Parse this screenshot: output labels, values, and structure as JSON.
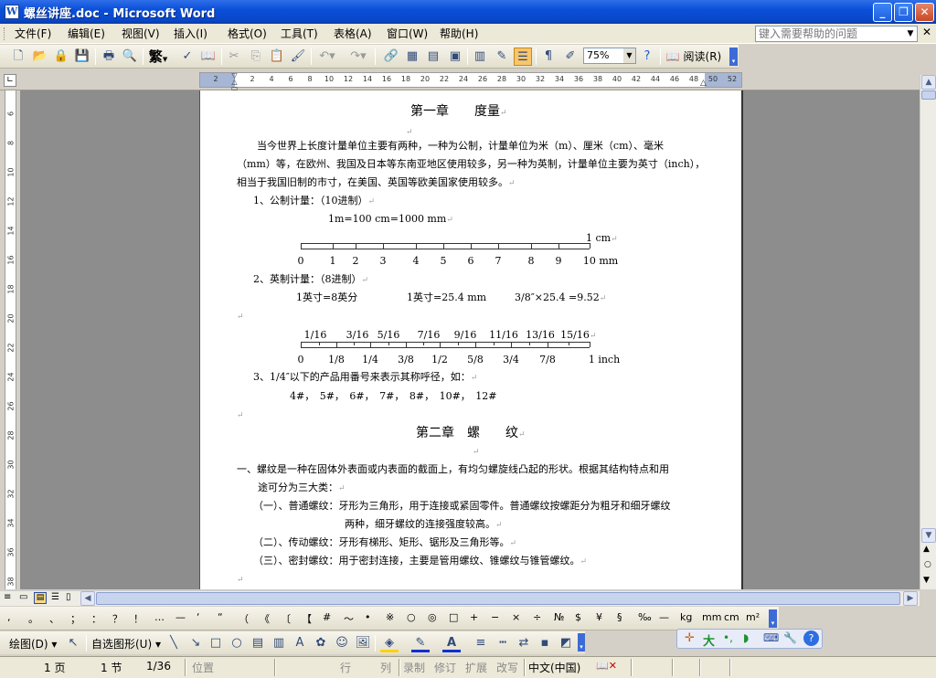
{
  "window": {
    "title": "螺丝讲座.doc - Microsoft Word",
    "min": "_",
    "max": "❐",
    "close": "✕"
  },
  "menu": [
    "文件(F)",
    "编辑(E)",
    "视图(V)",
    "插入(I)",
    "格式(O)",
    "工具(T)",
    "表格(A)",
    "窗口(W)",
    "帮助(H)"
  ],
  "help_placeholder": "键入需要帮助的问题",
  "toolbar": {
    "trad_simp": "繁",
    "zoom": "75%",
    "read": "阅读(R)"
  },
  "ruler_numbers": [
    "2",
    "2",
    "4",
    "6",
    "8",
    "10",
    "12",
    "14",
    "16",
    "18",
    "20",
    "22",
    "24",
    "26",
    "28",
    "30",
    "32",
    "34",
    "36",
    "38",
    "40",
    "42",
    "44",
    "46",
    "48",
    "50",
    "52"
  ],
  "vruler_numbers": [
    "6",
    "8",
    "10",
    "12",
    "14",
    "16",
    "18",
    "20",
    "22",
    "24",
    "26",
    "28",
    "30",
    "32",
    "34",
    "36",
    "38"
  ],
  "doc": {
    "ch1_title": "第一章　　度量",
    "p1_l1": "　　当今世界上长度计量单位主要有两种，一种为公制，计量单位为米（m）、厘米（cm）、毫米",
    "p1_l2": "（mm）等，在欧州、我国及日本等东南亚地区使用较多，另一种为英制，计量单位主要为英寸（inch），",
    "p1_l3": "相当于我国旧制的市寸，在美国、英国等欧美国家使用较多。",
    "s1": "1、公制计量：（10进制）",
    "s1_eq": "1m=100 cm=1000 mm",
    "metric_unit": "1 cm",
    "metric_labels": [
      "0",
      "1",
      "2",
      "3",
      "4",
      "5",
      "6",
      "7",
      "8",
      "9",
      "10 mm"
    ],
    "s2": "2、英制计量：（8进制）",
    "s2_eq1": "1英寸=8英分",
    "s2_eq2": "1英寸=25.4 mm",
    "s2_eq3": "3/8″×25.4 =9.52",
    "inch_top": [
      "1/16",
      "3/16",
      "5/16",
      "7/16",
      "9/16",
      "11/16",
      "13/16",
      "15/16"
    ],
    "inch_bottom": [
      "0",
      "1/8",
      "1/4",
      "3/8",
      "1/2",
      "5/8",
      "3/4",
      "7/8",
      "1 inch"
    ],
    "s3": "3、1/4″以下的产品用番号来表示其称呼径，如：",
    "s3_list": "4#，　5#，　6#，　7#，　8#，　10#，　12#",
    "ch2_title": "第二章　螺　　纹",
    "c1_l1": "一、螺纹是一种在固体外表面或内表面的截面上，有均匀螺旋线凸起的形状。根据其结构特点和用",
    "c1_l2": "途可分为三大类：",
    "c2_l1": "（一）、普通螺纹：牙形为三角形，用于连接或紧固零件。普通螺纹按螺距分为粗牙和细牙螺纹",
    "c2_l2": "两种，细牙螺纹的连接强度较高。",
    "c3": "（二）、传动螺纹：牙形有梯形、矩形、锯形及三角形等。",
    "c4": "（三）、密封螺纹：用于密封连接，主要是管用螺纹、锥螺纹与锥管螺纹。",
    "para_mark": "↵"
  },
  "symbols": [
    ",",
    "。",
    "、",
    "；",
    "：",
    "？",
    "！",
    "…",
    "—",
    "‘",
    "“",
    "（",
    "《",
    "〔",
    "【",
    "#",
    "～",
    "•",
    "※",
    "○",
    "◎",
    "□",
    "+",
    "−",
    "×",
    "÷",
    "№",
    "$",
    "¥",
    "§",
    "‰",
    "—",
    "kg",
    "mm",
    "cm",
    "m²"
  ],
  "drawbar": {
    "draw": "绘图(D)",
    "autoshape": "自选图形(U)"
  },
  "status": {
    "page": "1 页",
    "section": "1 节",
    "pages": "1/36",
    "at": "位置",
    "ln": "行",
    "col": "列",
    "rec": "录制",
    "trk": "修订",
    "ext": "扩展",
    "ovr": "改写",
    "lang": "中文(中国)"
  },
  "colors": {
    "titlebar": "#0a4fd9",
    "workspace": "#8d8d8d"
  }
}
